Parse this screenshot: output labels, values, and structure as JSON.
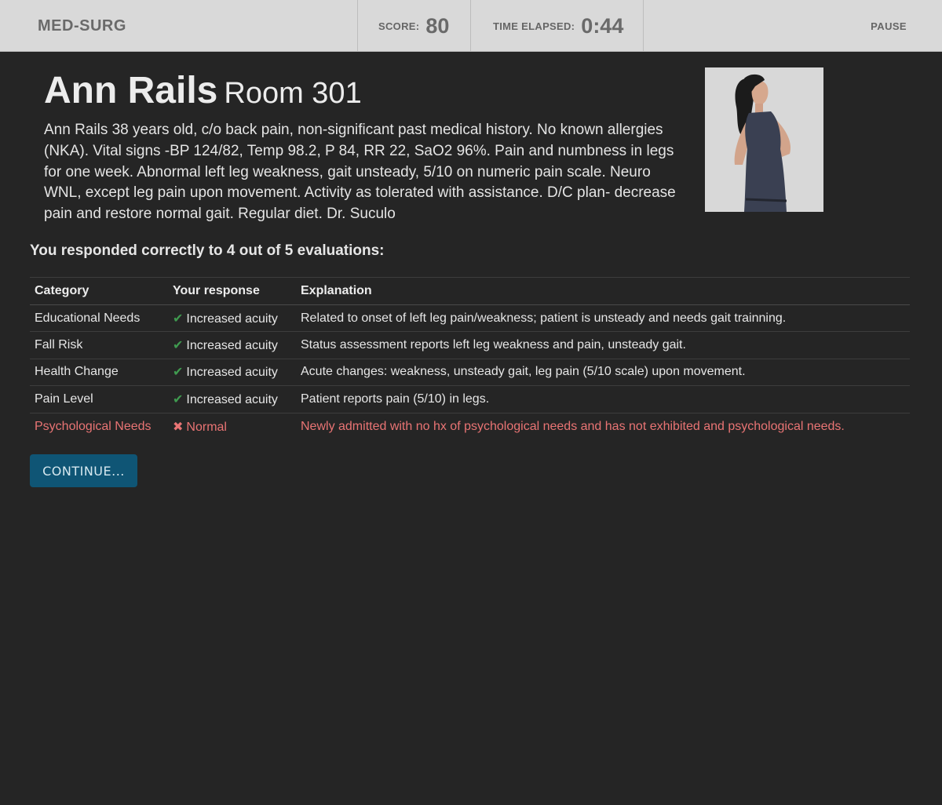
{
  "header": {
    "app_title": "MED-SURG",
    "score_label": "SCORE:",
    "score_value": "80",
    "time_label": "TIME ELAPSED:",
    "time_value": "0:44",
    "pause_label": "PAUSE"
  },
  "patient": {
    "name": "Ann Rails",
    "room": "Room 301",
    "description": "Ann Rails 38 years old, c/o back pain, non-significant past medical history. No known allergies (NKA). Vital signs -BP 124/82, Temp 98.2, P 84, RR 22, SaO2 96%. Pain and numbness in legs for one week. Abnormal left leg weakness, gait unsteady, 5/10 on numeric pain scale. Neuro WNL, except leg pain upon movement. Activity as tolerated with assistance. D/C plan- decrease pain and restore normal gait. Regular diet. Dr. Suculo"
  },
  "results": {
    "summary": "You responded correctly to 4 out of 5 evaluations:",
    "columns": [
      "Category",
      "Your response",
      "Explanation"
    ],
    "rows": [
      {
        "category": "Educational Needs",
        "response": "Increased acuity",
        "correct": true,
        "explanation": "Related to onset of left leg pain/weakness; patient is unsteady and needs gait trainning."
      },
      {
        "category": "Fall Risk",
        "response": "Increased acuity",
        "correct": true,
        "explanation": "Status assessment reports left leg weakness and pain, unsteady gait."
      },
      {
        "category": "Health Change",
        "response": "Increased acuity",
        "correct": true,
        "explanation": "Acute changes: weakness, unsteady gait, leg pain (5/10 scale) upon movement."
      },
      {
        "category": "Pain Level",
        "response": "Increased acuity",
        "correct": true,
        "explanation": "Patient reports pain (5/10) in legs."
      },
      {
        "category": "Psychological Needs",
        "response": "Normal",
        "correct": false,
        "explanation": "Newly admitted with no hx of psychological needs and has not exhibited and psychological needs."
      }
    ]
  },
  "actions": {
    "continue_label": "CONTINUE..."
  },
  "colors": {
    "background": "#252525",
    "topbar": "#d9d9d9",
    "correct": "#3f9a4f",
    "incorrect": "#e97474",
    "button": "#0f5575"
  },
  "icons": {
    "correct": "check-icon",
    "incorrect": "cross-icon"
  }
}
